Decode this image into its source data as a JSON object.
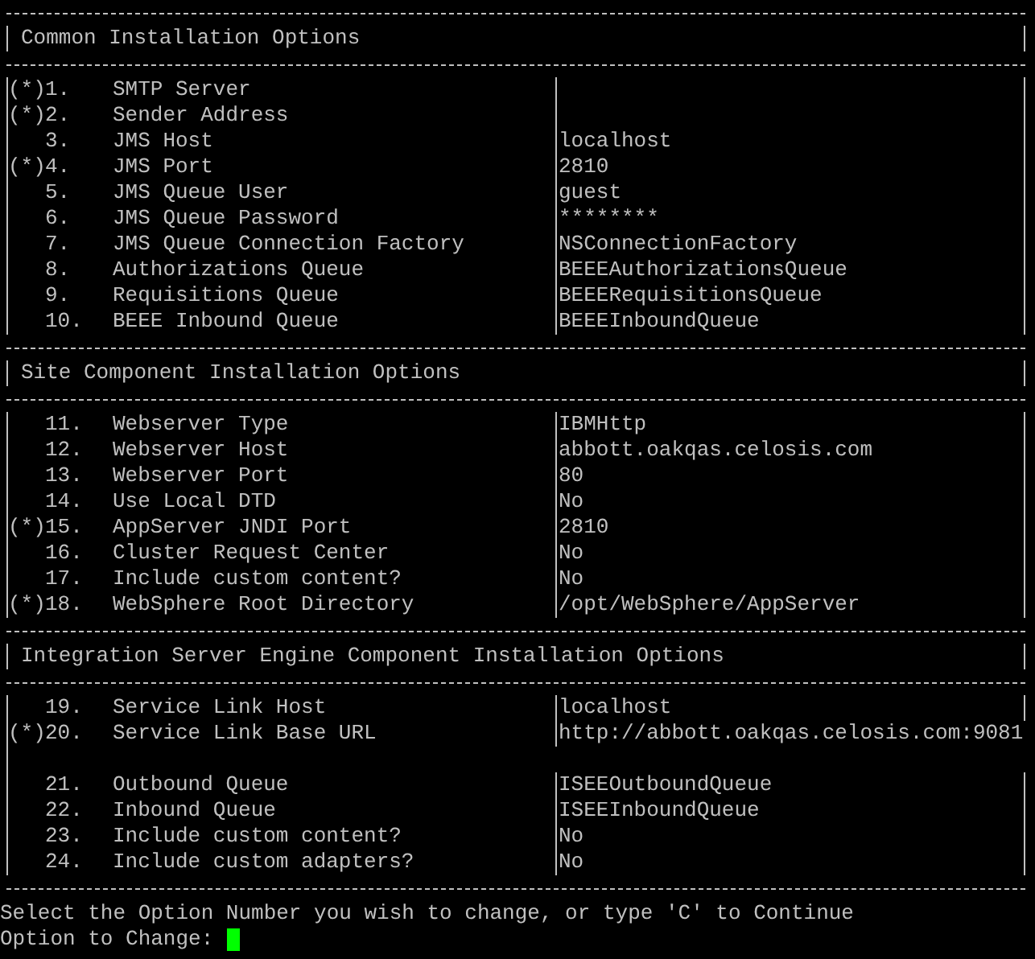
{
  "sections": [
    {
      "title": "Common Installation Options",
      "rows": [
        {
          "kind": "option",
          "marker": "(*)",
          "number": "1.",
          "label": "SMTP Server"
        },
        {
          "kind": "option",
          "marker": "(*)",
          "number": "2.",
          "label": "Sender Address"
        },
        {
          "kind": "option",
          "number": "3.",
          "label": "JMS Host",
          "value": "localhost"
        },
        {
          "kind": "option",
          "marker": "(*)",
          "number": "4.",
          "label": "JMS Port",
          "value": "2810"
        },
        {
          "kind": "option",
          "number": "5.",
          "label": "JMS Queue User",
          "value": "guest"
        },
        {
          "kind": "option",
          "number": "6.",
          "label": "JMS Queue Password",
          "value": "********"
        },
        {
          "kind": "option",
          "number": "7.",
          "label": "JMS Queue Connection Factory",
          "value": "NSConnectionFactory"
        },
        {
          "kind": "option",
          "number": "8.",
          "label": "Authorizations Queue",
          "value": "BEEEAuthorizationsQueue"
        },
        {
          "kind": "option",
          "number": "9.",
          "label": "Requisitions Queue",
          "value": "BEEERequisitionsQueue"
        },
        {
          "kind": "option",
          "number": "10.",
          "label": "BEEE Inbound Queue",
          "value": "BEEEInboundQueue"
        }
      ]
    },
    {
      "title": "Site Component Installation Options",
      "rows": [
        {
          "kind": "option",
          "number": "11.",
          "label": "Webserver Type",
          "value": "IBMHttp"
        },
        {
          "kind": "option",
          "number": "12.",
          "label": "Webserver Host",
          "value": "abbott.oakqas.celosis.com"
        },
        {
          "kind": "option",
          "number": "13.",
          "label": "Webserver Port",
          "value": "80"
        },
        {
          "kind": "option",
          "number": "14.",
          "label": "Use Local DTD",
          "value": "No"
        },
        {
          "kind": "option",
          "marker": "(*)",
          "number": "15.",
          "label": "AppServer JNDI Port",
          "value": "2810"
        },
        {
          "kind": "option",
          "number": "16.",
          "label": "Cluster Request Center",
          "value": "No"
        },
        {
          "kind": "option",
          "number": "17.",
          "label": "Include custom content?",
          "value": "No"
        },
        {
          "kind": "option",
          "marker": "(*)",
          "number": "18.",
          "label": "WebSphere Root Directory",
          "value": "/opt/WebSphere/AppServer"
        }
      ]
    },
    {
      "title": "Integration Server Engine Component Installation Options",
      "rows": [
        {
          "kind": "option",
          "number": "19.",
          "label": "Service Link Host",
          "value": "localhost"
        },
        {
          "kind": "overflow",
          "marker": "(*)",
          "number": "20.",
          "label": "Service Link Base URL",
          "value": "http://abbott.oakqas.celosis.com:9081"
        },
        {
          "kind": "blank"
        },
        {
          "kind": "option",
          "number": "21.",
          "label": "Outbound Queue",
          "value": "ISEEOutboundQueue"
        },
        {
          "kind": "option",
          "number": "22.",
          "label": "Inbound Queue",
          "value": "ISEEInboundQueue"
        },
        {
          "kind": "option",
          "number": "23.",
          "label": "Include custom content?",
          "value": "No"
        },
        {
          "kind": "option",
          "number": "24.",
          "label": "Include custom adapters?",
          "value": "No"
        }
      ]
    }
  ],
  "instruction": "Select the Option Number you wish to change, or type 'C' to Continue",
  "prompt": {
    "label": "Option to Change:"
  }
}
